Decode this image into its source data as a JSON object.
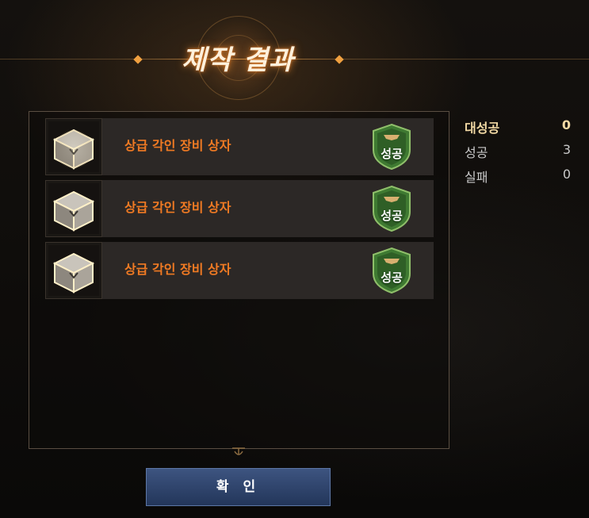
{
  "window": {
    "title": "제작 결과"
  },
  "results": [
    {
      "name": "상급 각인 장비 상자",
      "status": "성공",
      "icon": "equipment-chest-icon"
    },
    {
      "name": "상급 각인 장비 상자",
      "status": "성공",
      "icon": "equipment-chest-icon"
    },
    {
      "name": "상급 각인 장비 상자",
      "status": "성공",
      "icon": "equipment-chest-icon"
    }
  ],
  "summary": {
    "great_success": {
      "label": "대성공",
      "value": "0"
    },
    "success": {
      "label": "성공",
      "value": "3"
    },
    "failure": {
      "label": "실패",
      "value": "0"
    }
  },
  "confirm_button": {
    "label": "확 인"
  },
  "colors": {
    "item_name": "#f07a23",
    "great_success_label": "#f2d9a4",
    "badge_green": "#3f7a32",
    "button_blue": "#2f4670"
  }
}
